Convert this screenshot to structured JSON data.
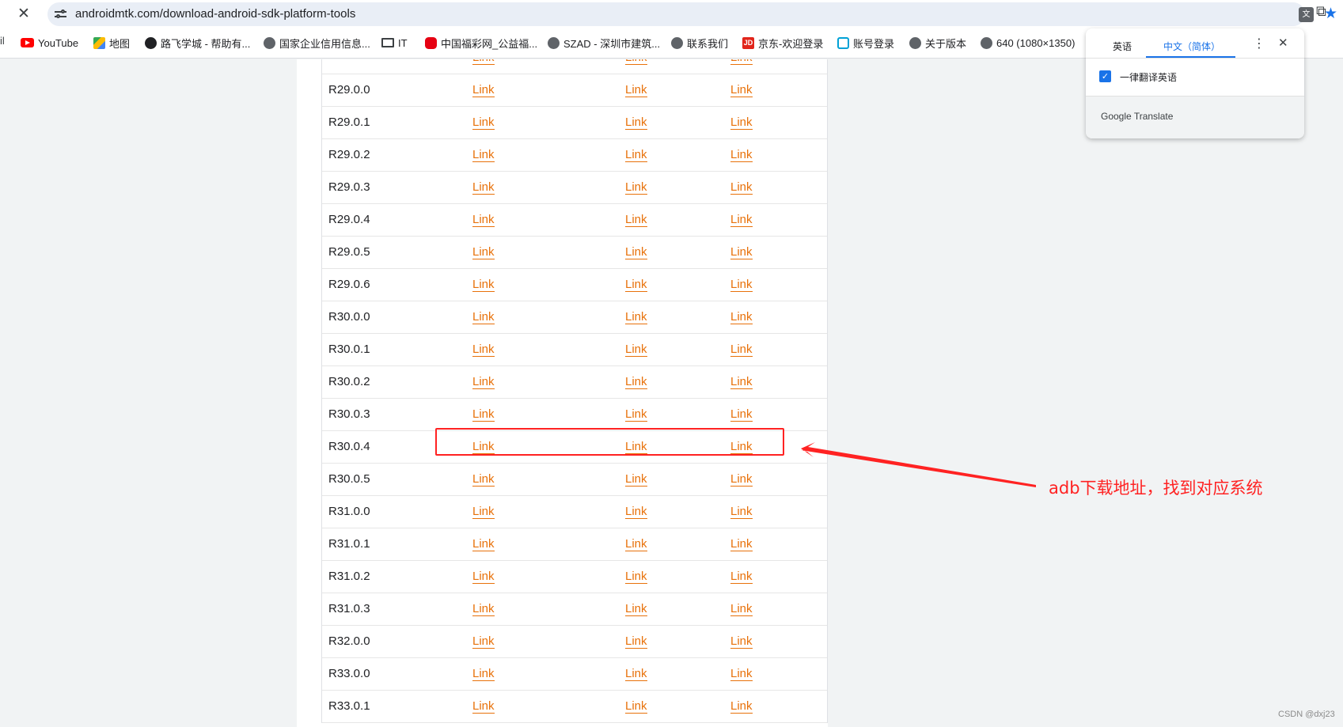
{
  "browser": {
    "url": "androidmtk.com/download-android-sdk-platform-tools",
    "icons": {
      "close": "close-icon",
      "site_info": "tune-icon",
      "translate": "translate-icon",
      "bookmark": "star-icon",
      "extensions": "extensions-icon"
    }
  },
  "bookmarks": {
    "partial_left": "il",
    "items": [
      {
        "label": "YouTube",
        "icon": "youtube-icon"
      },
      {
        "label": "地图",
        "icon": "maps-icon"
      },
      {
        "label": "路飞学城 - 帮助有...",
        "icon": "luffy-icon"
      },
      {
        "label": "国家企业信用信息...",
        "icon": "globe-icon"
      },
      {
        "label": "IT",
        "icon": "folder-icon"
      },
      {
        "label": "中国福彩网_公益福...",
        "icon": "cwl-icon"
      },
      {
        "label": "SZAD - 深圳市建筑...",
        "icon": "globe-icon"
      },
      {
        "label": "联系我们",
        "icon": "globe-icon"
      },
      {
        "label": "京东-欢迎登录",
        "icon": "jd-icon"
      },
      {
        "label": "账号登录",
        "icon": "bilibili-icon"
      },
      {
        "label": "关于版本",
        "icon": "globe-icon"
      },
      {
        "label": "640 (1080×1350)",
        "icon": "globe-icon"
      }
    ]
  },
  "table": {
    "link_label": "Link",
    "rows": [
      {
        "version": ""
      },
      {
        "version": "R29.0.0"
      },
      {
        "version": "R29.0.1"
      },
      {
        "version": "R29.0.2"
      },
      {
        "version": "R29.0.3"
      },
      {
        "version": "R29.0.4"
      },
      {
        "version": "R29.0.5"
      },
      {
        "version": "R29.0.6"
      },
      {
        "version": "R30.0.0"
      },
      {
        "version": "R30.0.1"
      },
      {
        "version": "R30.0.2"
      },
      {
        "version": "R30.0.3"
      },
      {
        "version": "R30.0.4"
      },
      {
        "version": "R30.0.5"
      },
      {
        "version": "R31.0.0"
      },
      {
        "version": "R31.0.1"
      },
      {
        "version": "R31.0.2"
      },
      {
        "version": "R31.0.3"
      },
      {
        "version": "R32.0.0"
      },
      {
        "version": "R33.0.0"
      },
      {
        "version": "R33.0.1"
      }
    ],
    "highlighted_version": "R30.0.4"
  },
  "annotation": {
    "text": "adb下载地址，找到对应系统",
    "color": "#ff2222"
  },
  "translate_popup": {
    "tab_source": "英语",
    "tab_target": "中文（简体）",
    "always_translate_label": "一律翻译英语",
    "always_translate_checked": true,
    "footer": "Google Translate",
    "accent": "#1a73e8"
  },
  "watermark": "CSDN @dxj23",
  "colors": {
    "link": "#e8710a",
    "page_bg": "#f1f3f4"
  }
}
